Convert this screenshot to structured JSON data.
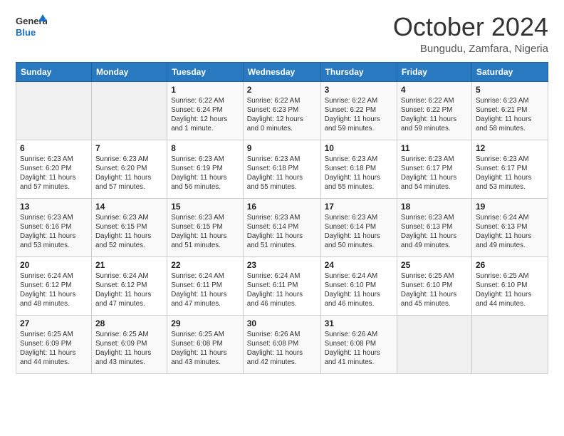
{
  "header": {
    "logo_line1": "General",
    "logo_line2": "Blue",
    "month": "October 2024",
    "location": "Bungudu, Zamfara, Nigeria"
  },
  "weekdays": [
    "Sunday",
    "Monday",
    "Tuesday",
    "Wednesday",
    "Thursday",
    "Friday",
    "Saturday"
  ],
  "weeks": [
    [
      {
        "day": "",
        "info": ""
      },
      {
        "day": "",
        "info": ""
      },
      {
        "day": "1",
        "info": "Sunrise: 6:22 AM\nSunset: 6:24 PM\nDaylight: 12 hours\nand 1 minute."
      },
      {
        "day": "2",
        "info": "Sunrise: 6:22 AM\nSunset: 6:23 PM\nDaylight: 12 hours\nand 0 minutes."
      },
      {
        "day": "3",
        "info": "Sunrise: 6:22 AM\nSunset: 6:22 PM\nDaylight: 11 hours\nand 59 minutes."
      },
      {
        "day": "4",
        "info": "Sunrise: 6:22 AM\nSunset: 6:22 PM\nDaylight: 11 hours\nand 59 minutes."
      },
      {
        "day": "5",
        "info": "Sunrise: 6:23 AM\nSunset: 6:21 PM\nDaylight: 11 hours\nand 58 minutes."
      }
    ],
    [
      {
        "day": "6",
        "info": "Sunrise: 6:23 AM\nSunset: 6:20 PM\nDaylight: 11 hours\nand 57 minutes."
      },
      {
        "day": "7",
        "info": "Sunrise: 6:23 AM\nSunset: 6:20 PM\nDaylight: 11 hours\nand 57 minutes."
      },
      {
        "day": "8",
        "info": "Sunrise: 6:23 AM\nSunset: 6:19 PM\nDaylight: 11 hours\nand 56 minutes."
      },
      {
        "day": "9",
        "info": "Sunrise: 6:23 AM\nSunset: 6:18 PM\nDaylight: 11 hours\nand 55 minutes."
      },
      {
        "day": "10",
        "info": "Sunrise: 6:23 AM\nSunset: 6:18 PM\nDaylight: 11 hours\nand 55 minutes."
      },
      {
        "day": "11",
        "info": "Sunrise: 6:23 AM\nSunset: 6:17 PM\nDaylight: 11 hours\nand 54 minutes."
      },
      {
        "day": "12",
        "info": "Sunrise: 6:23 AM\nSunset: 6:17 PM\nDaylight: 11 hours\nand 53 minutes."
      }
    ],
    [
      {
        "day": "13",
        "info": "Sunrise: 6:23 AM\nSunset: 6:16 PM\nDaylight: 11 hours\nand 53 minutes."
      },
      {
        "day": "14",
        "info": "Sunrise: 6:23 AM\nSunset: 6:15 PM\nDaylight: 11 hours\nand 52 minutes."
      },
      {
        "day": "15",
        "info": "Sunrise: 6:23 AM\nSunset: 6:15 PM\nDaylight: 11 hours\nand 51 minutes."
      },
      {
        "day": "16",
        "info": "Sunrise: 6:23 AM\nSunset: 6:14 PM\nDaylight: 11 hours\nand 51 minutes."
      },
      {
        "day": "17",
        "info": "Sunrise: 6:23 AM\nSunset: 6:14 PM\nDaylight: 11 hours\nand 50 minutes."
      },
      {
        "day": "18",
        "info": "Sunrise: 6:23 AM\nSunset: 6:13 PM\nDaylight: 11 hours\nand 49 minutes."
      },
      {
        "day": "19",
        "info": "Sunrise: 6:24 AM\nSunset: 6:13 PM\nDaylight: 11 hours\nand 49 minutes."
      }
    ],
    [
      {
        "day": "20",
        "info": "Sunrise: 6:24 AM\nSunset: 6:12 PM\nDaylight: 11 hours\nand 48 minutes."
      },
      {
        "day": "21",
        "info": "Sunrise: 6:24 AM\nSunset: 6:12 PM\nDaylight: 11 hours\nand 47 minutes."
      },
      {
        "day": "22",
        "info": "Sunrise: 6:24 AM\nSunset: 6:11 PM\nDaylight: 11 hours\nand 47 minutes."
      },
      {
        "day": "23",
        "info": "Sunrise: 6:24 AM\nSunset: 6:11 PM\nDaylight: 11 hours\nand 46 minutes."
      },
      {
        "day": "24",
        "info": "Sunrise: 6:24 AM\nSunset: 6:10 PM\nDaylight: 11 hours\nand 46 minutes."
      },
      {
        "day": "25",
        "info": "Sunrise: 6:25 AM\nSunset: 6:10 PM\nDaylight: 11 hours\nand 45 minutes."
      },
      {
        "day": "26",
        "info": "Sunrise: 6:25 AM\nSunset: 6:10 PM\nDaylight: 11 hours\nand 44 minutes."
      }
    ],
    [
      {
        "day": "27",
        "info": "Sunrise: 6:25 AM\nSunset: 6:09 PM\nDaylight: 11 hours\nand 44 minutes."
      },
      {
        "day": "28",
        "info": "Sunrise: 6:25 AM\nSunset: 6:09 PM\nDaylight: 11 hours\nand 43 minutes."
      },
      {
        "day": "29",
        "info": "Sunrise: 6:25 AM\nSunset: 6:08 PM\nDaylight: 11 hours\nand 43 minutes."
      },
      {
        "day": "30",
        "info": "Sunrise: 6:26 AM\nSunset: 6:08 PM\nDaylight: 11 hours\nand 42 minutes."
      },
      {
        "day": "31",
        "info": "Sunrise: 6:26 AM\nSunset: 6:08 PM\nDaylight: 11 hours\nand 41 minutes."
      },
      {
        "day": "",
        "info": ""
      },
      {
        "day": "",
        "info": ""
      }
    ]
  ]
}
